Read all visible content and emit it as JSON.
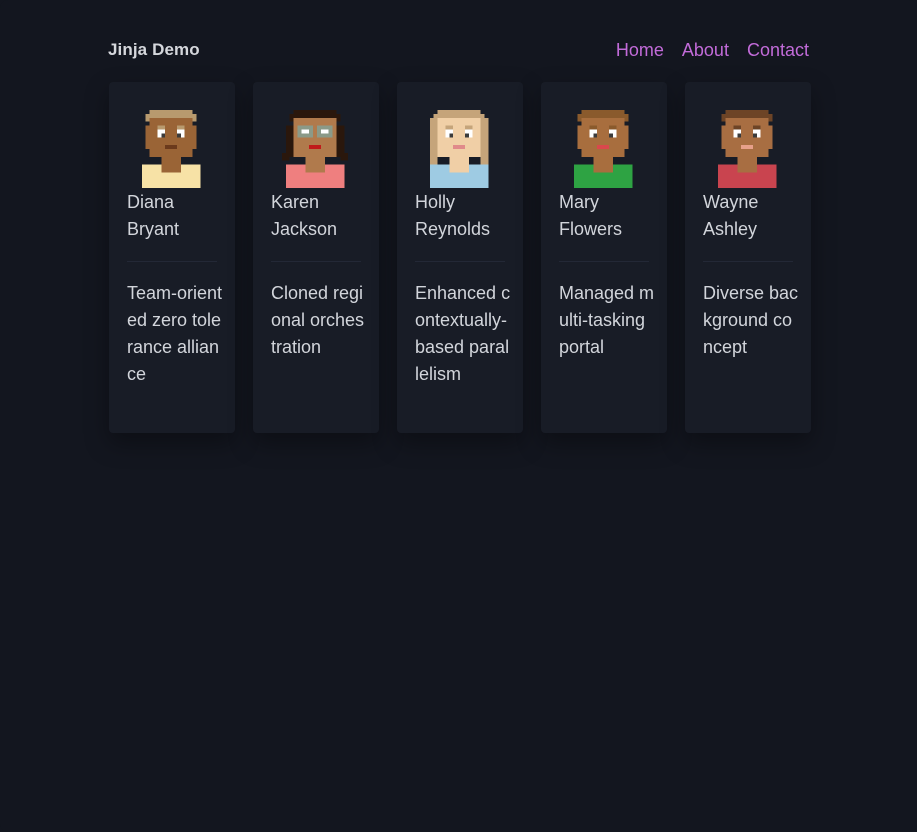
{
  "navbar": {
    "brand": "Jinja Demo",
    "links": [
      {
        "label": "Home"
      },
      {
        "label": "About"
      },
      {
        "label": "Contact"
      }
    ]
  },
  "people": [
    {
      "first": "Diana",
      "last": "Bryant",
      "description": "Team-oriented zero tolerance alliance",
      "avatar": {
        "skin": "#9a6436",
        "hair": "#b89a6e",
        "shirt": "#f7e2a6",
        "accent": "#6b3a1c"
      }
    },
    {
      "first": "Karen",
      "last": "Jackson",
      "description": "Cloned regional orchestration",
      "avatar": {
        "skin": "#b07a4c",
        "hair": "#2a170c",
        "shirt": "#ef7f7f",
        "accent": "#c01a1a"
      }
    },
    {
      "first": "Holly",
      "last": "Reynolds",
      "description": "Enhanced contextually-based parallelism",
      "avatar": {
        "skin": "#f0cfa6",
        "hair": "#c5a47a",
        "shirt": "#9ecbe3",
        "accent": "#e08a8a"
      }
    },
    {
      "first": "Mary",
      "last": "Flowers",
      "description": "Managed multi-tasking portal",
      "avatar": {
        "skin": "#a86e3e",
        "hair": "#8a5a2c",
        "shirt": "#2ea343",
        "accent": "#d9484c"
      }
    },
    {
      "first": "Wayne",
      "last": "Ashley",
      "description": "Diverse background concept",
      "avatar": {
        "skin": "#a86e42",
        "hair": "#6d4426",
        "shirt": "#c9444f",
        "accent": "#e7a08a"
      }
    }
  ],
  "colors": {
    "background": "#13161f",
    "card": "#181c26",
    "text": "#d2d5db",
    "link": "#c26bd9"
  }
}
